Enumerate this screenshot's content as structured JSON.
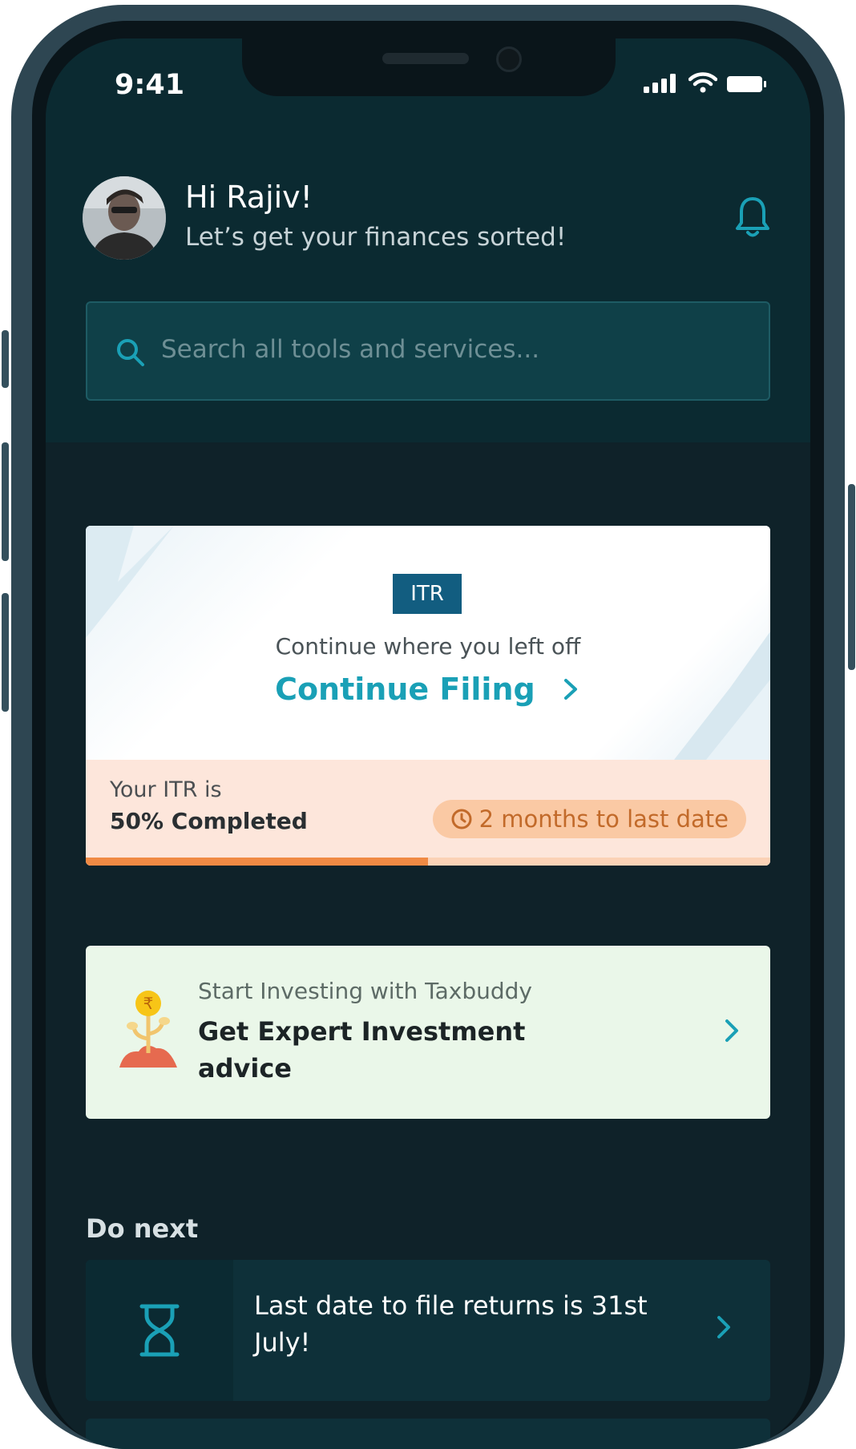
{
  "status_bar": {
    "time": "9:41"
  },
  "header": {
    "greeting": "Hi Rajiv!",
    "subtitle": "Let’s get your finances sorted!"
  },
  "search": {
    "placeholder": "Search all tools and services..."
  },
  "itr_card": {
    "badge": "ITR",
    "subtitle": "Continue where you left off",
    "cta_label": "Continue Filing",
    "status_label": "Your ITR is",
    "status_value": "50% Completed",
    "progress_fraction": 0.5,
    "deadline_label": "2 months to last date"
  },
  "invest_card": {
    "small_text": "Start Investing with Taxbuddy",
    "title": "Get Expert Investment advice",
    "coin_symbol": "₹"
  },
  "do_next": {
    "section_title": "Do next",
    "items": [
      {
        "text": "Last date to file returns is 31st July!"
      }
    ]
  },
  "colors": {
    "screen_bg": "#0f2229",
    "accent_teal": "#1aa0b6",
    "progress_orange": "#f08a44",
    "badge_blue": "#125d80"
  }
}
